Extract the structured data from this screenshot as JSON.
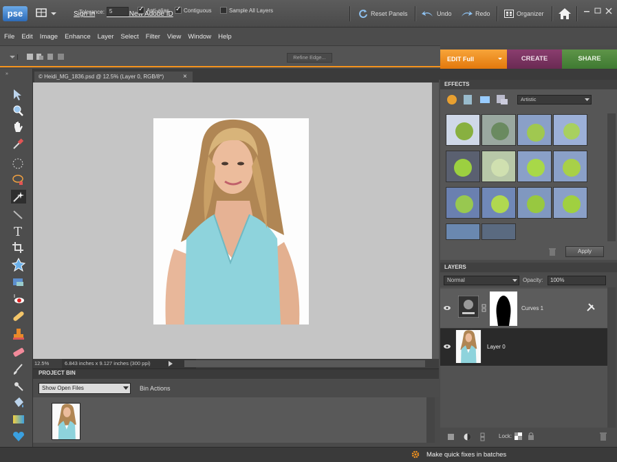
{
  "app": {
    "logo": "pse"
  },
  "topbar": {
    "sign_in": "Sign In",
    "create_id": "Create New Adobe ID",
    "reset_panels": "Reset Panels",
    "undo": "Undo",
    "redo": "Redo",
    "organizer": "Organizer"
  },
  "menu": [
    "File",
    "Edit",
    "Image",
    "Enhance",
    "Layer",
    "Select",
    "Filter",
    "View",
    "Window",
    "Help"
  ],
  "options": {
    "tolerance_label": "Tolerance:",
    "tolerance_value": "5",
    "anti_alias": "Anti-alias",
    "contiguous": "Contiguous",
    "sample_all_layers": "Sample All Layers",
    "refine_edge": "Refine Edge..."
  },
  "modes": {
    "edit": "EDIT Full",
    "create": "CREATE",
    "share": "SHARE"
  },
  "document": {
    "tab_title": "© Heidi_MG_1836.psd @ 12.5% (Layer 0, RGB/8*)",
    "zoom": "12.5%",
    "doc_info": "6.843 inches x 9.127 inches (300 ppi)"
  },
  "project_bin": {
    "title": "PROJECT BIN",
    "show": "Show Open Files",
    "actions": "Bin Actions"
  },
  "effects": {
    "title": "EFFECTS",
    "category": "Artistic",
    "apply": "Apply"
  },
  "layers": {
    "title": "LAYERS",
    "blend_mode": "Normal",
    "opacity_label": "Opacity:",
    "opacity_value": "100%",
    "items": [
      {
        "name": "Curves 1"
      },
      {
        "name": "Layer 0"
      }
    ],
    "lock_label": "Lock:"
  },
  "statusbar": {
    "batch_tip": "Make quick fixes in batches"
  }
}
